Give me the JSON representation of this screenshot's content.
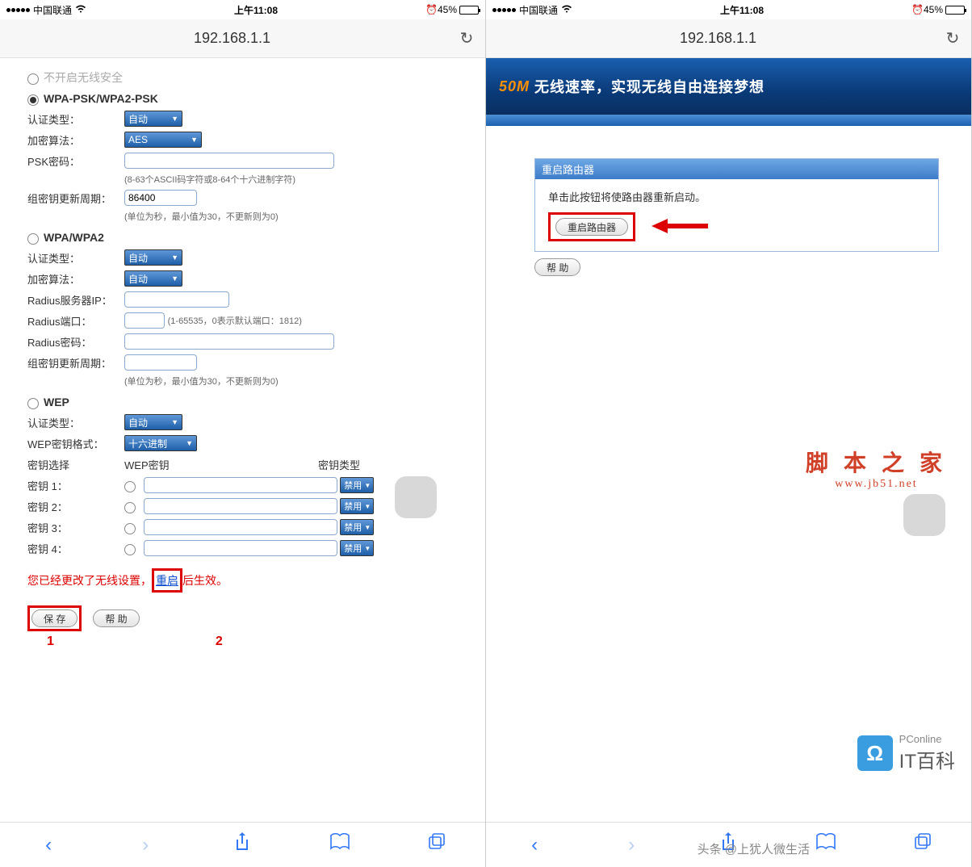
{
  "status": {
    "carrier": "中国联通",
    "time": "上午11:08",
    "battery": "45%",
    "alarm": "⏰"
  },
  "url": "192.168.1.1",
  "left": {
    "topOption": "不开启无线安全",
    "wpapsk": {
      "title": "WPA-PSK/WPA2-PSK",
      "authLabel": "认证类型：",
      "authVal": "自动",
      "encLabel": "加密算法：",
      "encVal": "AES",
      "pskLabel": "PSK密码：",
      "pskHint": "(8-63个ASCII码字符或8-64个十六进制字符)",
      "gkLabel": "组密钥更新周期：",
      "gkVal": "86400",
      "gkHint": "(单位为秒，最小值为30，不更新则为0)"
    },
    "wpa": {
      "title": "WPA/WPA2",
      "authLabel": "认证类型：",
      "authVal": "自动",
      "encLabel": "加密算法：",
      "encVal": "自动",
      "radiusIpLabel": "Radius服务器IP：",
      "radiusPortLabel": "Radius端口：",
      "radiusPortHint": "(1-65535，0表示默认端口：1812)",
      "radiusPwLabel": "Radius密码：",
      "gkLabel": "组密钥更新周期：",
      "gkHint": "(单位为秒，最小值为30，不更新则为0)"
    },
    "wep": {
      "title": "WEP",
      "authLabel": "认证类型：",
      "authVal": "自动",
      "fmtLabel": "WEP密钥格式：",
      "fmtVal": "十六进制",
      "keyColLabel": "密钥选择",
      "keyColVal": "WEP密钥",
      "typeCol": "密钥类型",
      "keys": [
        {
          "lbl": "密钥 1：",
          "type": "禁用"
        },
        {
          "lbl": "密钥 2：",
          "type": "禁用"
        },
        {
          "lbl": "密钥 3：",
          "type": "禁用"
        },
        {
          "lbl": "密钥 4：",
          "type": "禁用"
        }
      ]
    },
    "notice": {
      "pre": "您已经更改了无线设置，",
      "link": "重启",
      "post": "后生效。"
    },
    "save": "保 存",
    "help": "帮 助",
    "annot1": "1",
    "annot2": "2"
  },
  "right": {
    "bannerSpeed": "50M",
    "bannerText": "无线速率，实现无线自由连接梦想",
    "panelTitle": "重启路由器",
    "panelDesc": "单击此按钮将使路由器重新启动。",
    "rebootBtn": "重启路由器",
    "helpBtn": "帮 助",
    "wmTitle": "脚 本 之 家",
    "wmUrl": "www.jb51.net",
    "pcBrand": "PConline",
    "pcTag": "IT百科",
    "byline": "头条 @上犹人微生活"
  },
  "nav": {
    "back": "‹",
    "fwd": "›",
    "share": "⇪",
    "books": "📖",
    "tabs": "⧉"
  }
}
